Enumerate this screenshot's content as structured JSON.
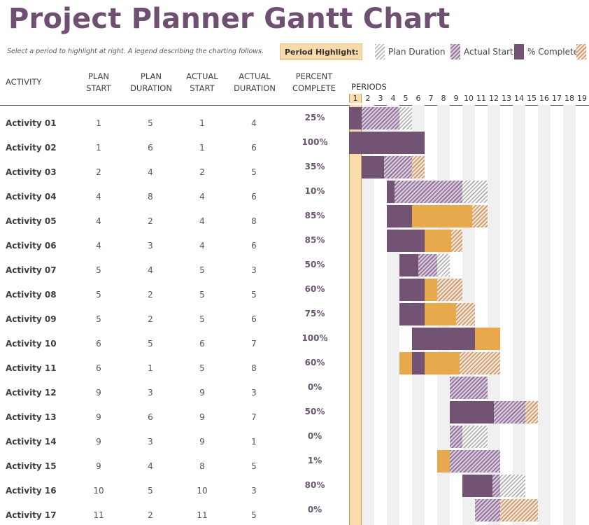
{
  "title": "Project Planner Gantt Chart",
  "subtitle": "Select a period to highlight at right.  A legend describing the charting follows.",
  "period_highlight": {
    "label": "Period Highlight:",
    "value": "1"
  },
  "legend": [
    {
      "label": "Plan Duration",
      "icon": "plan-duration-swatch"
    },
    {
      "label": "Actual Start",
      "icon": "actual-start-swatch"
    },
    {
      "label": "% Complete",
      "icon": "percent-complete-swatch"
    },
    {
      "label": "",
      "icon": "actual-beyond-plan-swatch"
    }
  ],
  "headers": {
    "activity": "ACTIVITY",
    "plan_start": [
      "PLAN",
      "START"
    ],
    "plan_duration": [
      "PLAN",
      "DURATION"
    ],
    "actual_start": [
      "ACTUAL",
      "START"
    ],
    "actual_duration": [
      "ACTUAL",
      "DURATION"
    ],
    "percent_complete": [
      "PERCENT",
      "COMPLETE"
    ],
    "periods": "PERIODS"
  },
  "colors": {
    "title": "#6f4f72",
    "complete": "#735373",
    "beyond": "#e8a94c",
    "highlight": "#f8dcae"
  },
  "chart_data": {
    "type": "gantt",
    "title": "Project Planner Gantt Chart",
    "periods": [
      1,
      2,
      3,
      4,
      5,
      6,
      7,
      8,
      9,
      10,
      11,
      12,
      13,
      14,
      15,
      16,
      17,
      18,
      19
    ],
    "highlighted_period": 1,
    "activities": [
      {
        "name": "Activity 01",
        "plan_start": 1,
        "plan_duration": 5,
        "actual_start": 1,
        "actual_duration": 4,
        "percent": "25%"
      },
      {
        "name": "Activity 02",
        "plan_start": 1,
        "plan_duration": 6,
        "actual_start": 1,
        "actual_duration": 6,
        "percent": "100%"
      },
      {
        "name": "Activity 03",
        "plan_start": 2,
        "plan_duration": 4,
        "actual_start": 2,
        "actual_duration": 5,
        "percent": "35%"
      },
      {
        "name": "Activity 04",
        "plan_start": 4,
        "plan_duration": 8,
        "actual_start": 4,
        "actual_duration": 6,
        "percent": "10%"
      },
      {
        "name": "Activity 05",
        "plan_start": 4,
        "plan_duration": 2,
        "actual_start": 4,
        "actual_duration": 8,
        "percent": "85%"
      },
      {
        "name": "Activity 06",
        "plan_start": 4,
        "plan_duration": 3,
        "actual_start": 4,
        "actual_duration": 6,
        "percent": "85%"
      },
      {
        "name": "Activity 07",
        "plan_start": 5,
        "plan_duration": 4,
        "actual_start": 5,
        "actual_duration": 3,
        "percent": "50%"
      },
      {
        "name": "Activity 08",
        "plan_start": 5,
        "plan_duration": 2,
        "actual_start": 5,
        "actual_duration": 5,
        "percent": "60%"
      },
      {
        "name": "Activity 09",
        "plan_start": 5,
        "plan_duration": 2,
        "actual_start": 5,
        "actual_duration": 6,
        "percent": "75%"
      },
      {
        "name": "Activity 10",
        "plan_start": 6,
        "plan_duration": 5,
        "actual_start": 6,
        "actual_duration": 7,
        "percent": "100%"
      },
      {
        "name": "Activity 11",
        "plan_start": 6,
        "plan_duration": 1,
        "actual_start": 5,
        "actual_duration": 8,
        "percent": "60%"
      },
      {
        "name": "Activity 12",
        "plan_start": 9,
        "plan_duration": 3,
        "actual_start": 9,
        "actual_duration": 3,
        "percent": "0%"
      },
      {
        "name": "Activity 13",
        "plan_start": 9,
        "plan_duration": 6,
        "actual_start": 9,
        "actual_duration": 7,
        "percent": "50%"
      },
      {
        "name": "Activity 14",
        "plan_start": 9,
        "plan_duration": 3,
        "actual_start": 9,
        "actual_duration": 1,
        "percent": "0%"
      },
      {
        "name": "Activity 15",
        "plan_start": 9,
        "plan_duration": 4,
        "actual_start": 8,
        "actual_duration": 5,
        "percent": "1%"
      },
      {
        "name": "Activity 16",
        "plan_start": 10,
        "plan_duration": 5,
        "actual_start": 10,
        "actual_duration": 3,
        "percent": "80%"
      },
      {
        "name": "Activity 17",
        "plan_start": 11,
        "plan_duration": 2,
        "actual_start": 11,
        "actual_duration": 5,
        "percent": "0%"
      }
    ]
  }
}
